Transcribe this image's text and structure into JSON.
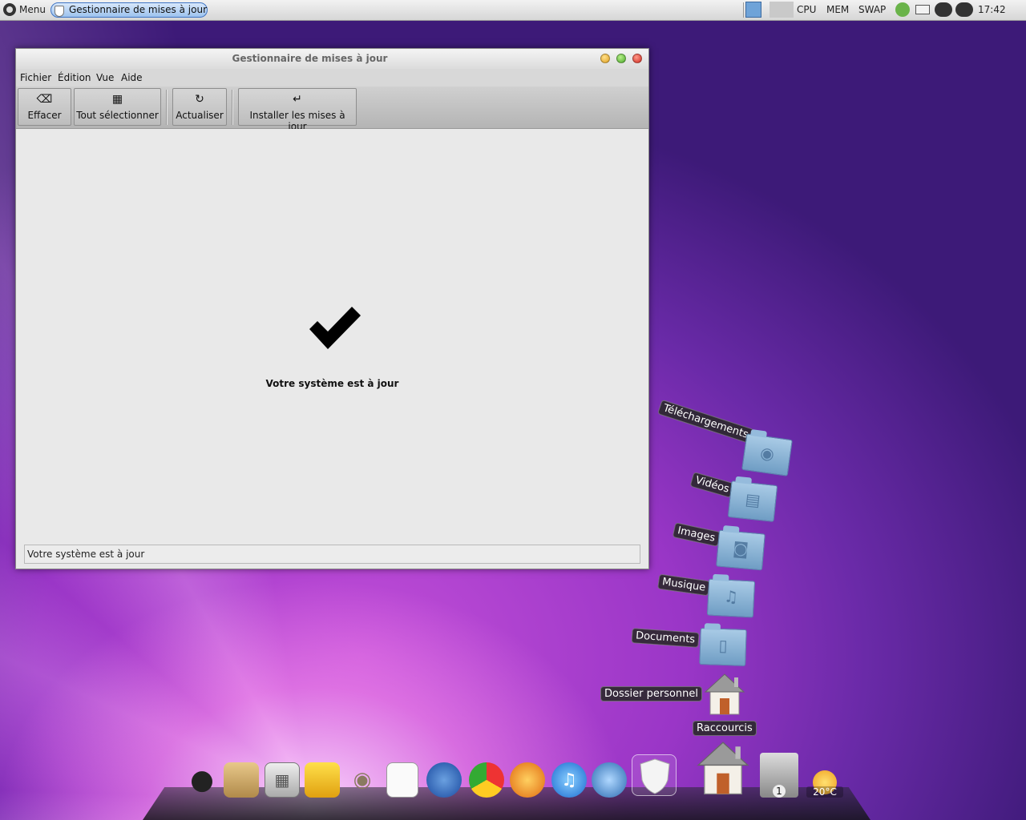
{
  "panel": {
    "menu_label": "Menu",
    "task_label": "Gestionnaire de mises à jour",
    "cpu": "CPU",
    "mem": "MEM",
    "swap": "SWAP",
    "time": "17:42"
  },
  "window": {
    "title": "Gestionnaire de mises à jour",
    "menu": [
      "Fichier",
      "Édition",
      "Vue",
      "Aide"
    ],
    "toolbar": [
      {
        "label": "Effacer",
        "icon": "clear-icon"
      },
      {
        "label": "Tout sélectionner",
        "icon": "select-all-icon"
      },
      {
        "label": "Actualiser",
        "icon": "refresh-icon"
      },
      {
        "label": "Installer les mises à jour",
        "icon": "install-icon"
      }
    ],
    "message": "Votre système est à jour",
    "status": "Votre système est à jour"
  },
  "stack": {
    "items": [
      {
        "label": "Téléchargements",
        "icon": "download-folder-icon"
      },
      {
        "label": "Vidéos",
        "icon": "videos-folder-icon"
      },
      {
        "label": "Images",
        "icon": "pictures-folder-icon"
      },
      {
        "label": "Musique",
        "icon": "music-folder-icon"
      },
      {
        "label": "Documents",
        "icon": "documents-folder-icon"
      },
      {
        "label": "Dossier personnel",
        "icon": "home-folder-icon"
      }
    ],
    "shortcuts_label": "Raccourcis"
  },
  "dock": {
    "trash_count": "1",
    "weather": "20°C"
  }
}
